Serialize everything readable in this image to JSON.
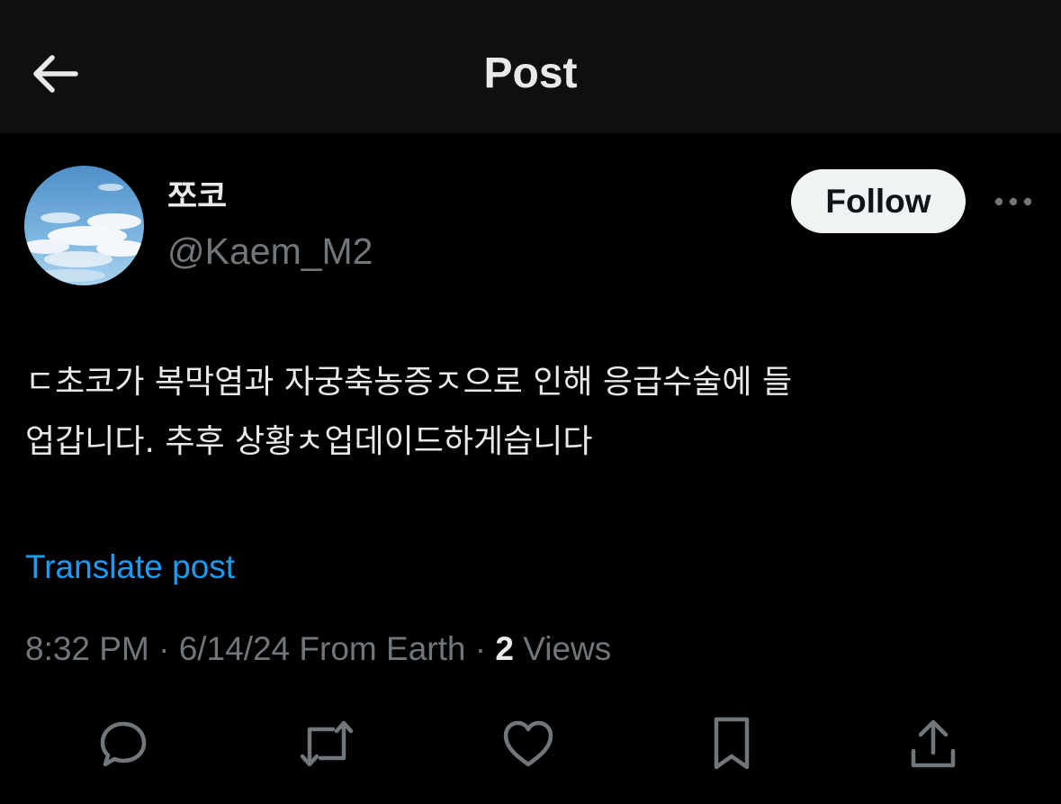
{
  "header": {
    "title": "Post",
    "back_icon": "arrow-left-icon"
  },
  "author": {
    "display_name": "쪼코",
    "handle": "@Kaem_M2",
    "avatar": "sky-clouds-avatar"
  },
  "follow_label": "Follow",
  "more_icon": "ellipsis-icon",
  "post": {
    "text": "ㄷ초코가 복막염과 자궁축농증ㅈ으로 인해 응급수술에 들\n업갑니다. 추후 상황ㅊ업데이드하게습니다",
    "translate_label": "Translate post"
  },
  "meta": {
    "time": "8:32 PM",
    "sep1": " · ",
    "date": "6/14/24",
    "source": " From Earth",
    "sep2": " · ",
    "views_count": "2",
    "views_label": " Views"
  },
  "actions": [
    {
      "icon": "reply-icon"
    },
    {
      "icon": "repost-icon"
    },
    {
      "icon": "like-icon"
    },
    {
      "icon": "bookmark-icon"
    },
    {
      "icon": "share-icon"
    }
  ],
  "colors": {
    "background": "#000000",
    "header_background": "#0f0f0f",
    "text_primary": "#e7e9ea",
    "text_secondary": "#71767b",
    "link": "#1d9bf0",
    "follow_button": "#eff3f4"
  }
}
